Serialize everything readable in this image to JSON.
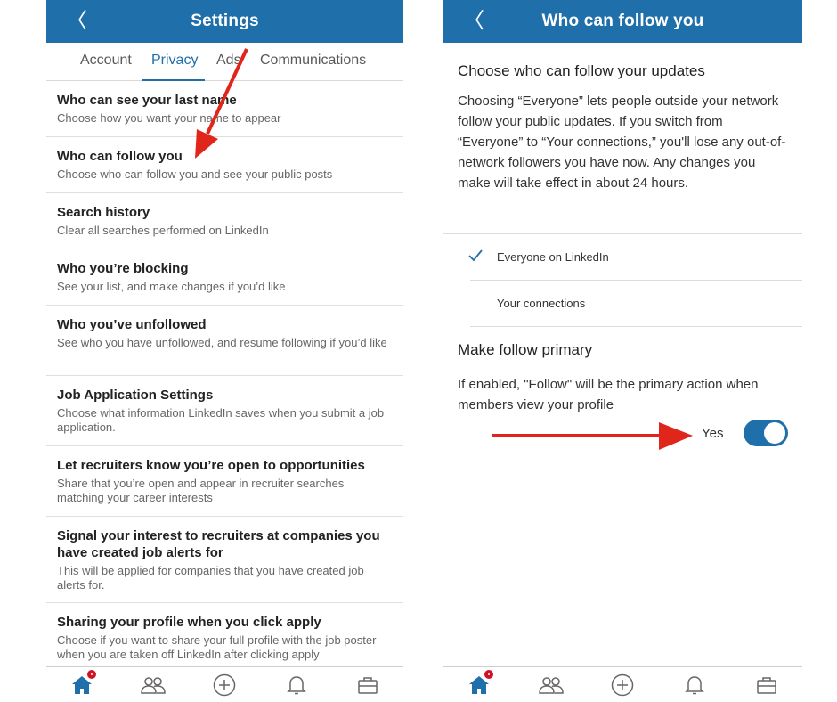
{
  "left": {
    "header": {
      "back_glyph": "〈",
      "title": "Settings"
    },
    "tabs": [
      {
        "label": "Account",
        "active": false
      },
      {
        "label": "Privacy",
        "active": true
      },
      {
        "label": "Ads",
        "active": false
      },
      {
        "label": "Communications",
        "active": false
      }
    ],
    "rows": [
      {
        "title": "Who can see your last name",
        "sub": "Choose how you want your name to appear"
      },
      {
        "title": "Who can follow you",
        "sub": "Choose who can follow you and see your public posts"
      },
      {
        "title": "Search history",
        "sub": "Clear all searches performed on LinkedIn"
      },
      {
        "title": "Who you’re blocking",
        "sub": "See your list, and make changes if you’d like"
      },
      {
        "title": "Who you’ve unfollowed",
        "sub": "See who you have unfollowed, and resume following if you’d like"
      },
      {
        "title": "Job Application Settings",
        "sub": "Choose what information LinkedIn saves when you submit a job application."
      },
      {
        "title": "Let recruiters know you’re open to opportunities",
        "sub": "Share that you’re open and appear in recruiter searches matching your career interests"
      },
      {
        "title": "Signal your interest to recruiters at companies you have created job alerts for",
        "sub": "This will be applied for companies that you have created job alerts for."
      },
      {
        "title": "Sharing your profile when you click apply",
        "sub": "Choose if you want to share your full profile with the job poster when you are taken off LinkedIn after clicking apply"
      }
    ]
  },
  "right": {
    "header": {
      "back_glyph": "〈",
      "title": "Who can follow you"
    },
    "section1_title": "Choose who can follow your updates",
    "section1_body": "Choosing “Everyone” lets people outside your network follow your public updates. If you switch from “Everyone” to “Your connections,” you'll lose any out-of-network followers you have now. Any changes you make will take effect in about 24 hours.",
    "options": [
      {
        "label": "Everyone on LinkedIn",
        "selected": true
      },
      {
        "label": "Your connections",
        "selected": false
      }
    ],
    "section2_title": "Make follow primary",
    "section2_body": "If enabled, \"Follow\" will be the primary action when members view your profile",
    "toggle": {
      "label": "Yes",
      "on": true
    }
  },
  "nav": [
    "home-icon",
    "my-network-icon",
    "post-icon",
    "notifications-icon",
    "jobs-icon"
  ],
  "colors": {
    "brand": "#1f6fab",
    "badge": "#d11124",
    "arrow": "#e0261b",
    "text": "#222222",
    "subtext": "#666666"
  }
}
